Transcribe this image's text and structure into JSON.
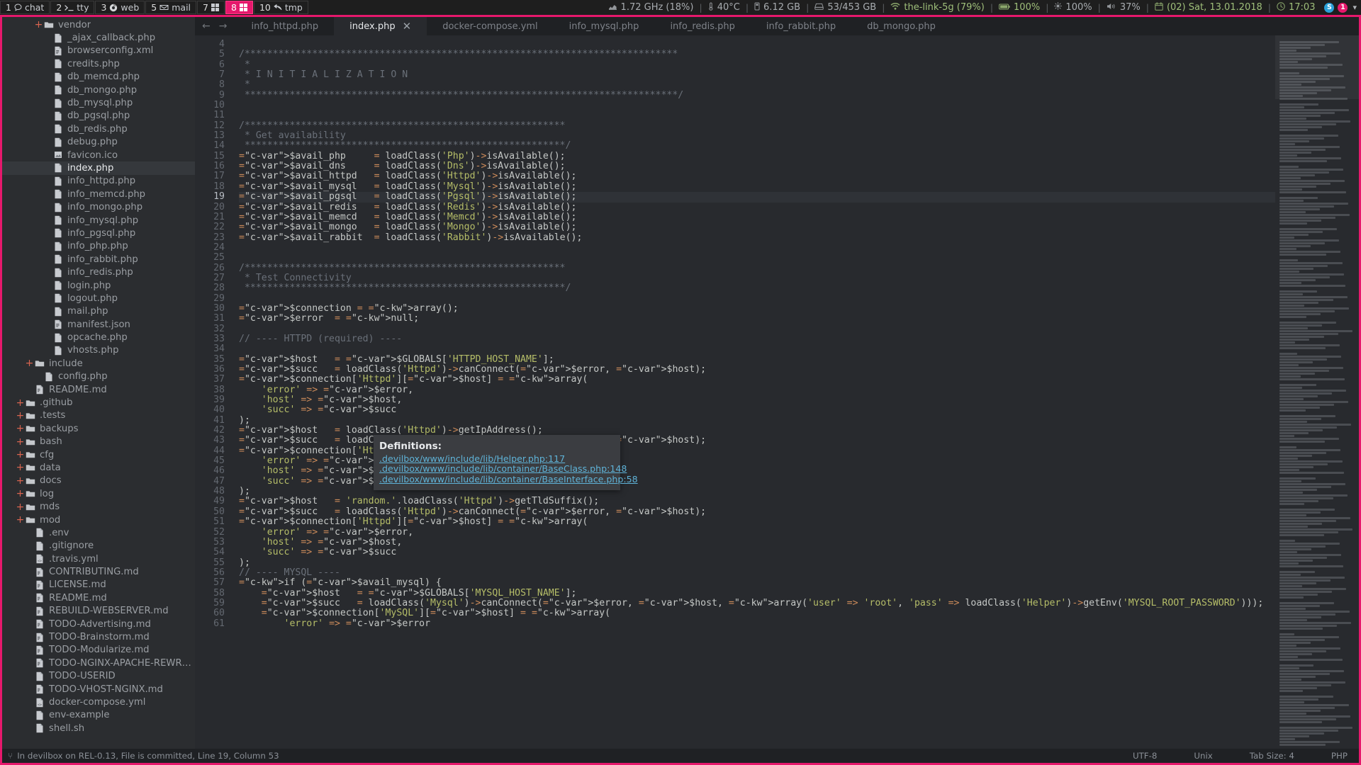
{
  "i3bar": {
    "workspaces": [
      {
        "num": "1",
        "icon": "chat-bubble-icon",
        "label": "chat",
        "active": false
      },
      {
        "num": "2",
        "icon": "terminal-prompt-icon",
        "label": "tty",
        "active": false
      },
      {
        "num": "3",
        "icon": "chrome-icon",
        "label": "web",
        "active": false
      },
      {
        "num": "5",
        "icon": "mail-icon",
        "label": "mail",
        "active": false
      },
      {
        "num": "7",
        "icon": "grid-squares-icon",
        "label": "",
        "active": false
      },
      {
        "num": "8",
        "icon": "grid-squares-icon",
        "label": "",
        "active": true
      },
      {
        "num": "10",
        "icon": "back-arrow-icon",
        "label": "tmp",
        "active": false
      }
    ],
    "tray": [
      {
        "icon": "cpu-chart-icon",
        "text": "1.72 GHz (18%)",
        "color": "#a8acb0"
      },
      {
        "icon": "thermometer-icon",
        "text": "40°C",
        "color": "#a8acb0"
      },
      {
        "icon": "memory-icon",
        "text": "6.12 GB",
        "color": "#a8acb0"
      },
      {
        "icon": "harddisk-icon",
        "text": "53/453 GB",
        "color": "#a8acb0"
      },
      {
        "icon": "wifi-icon",
        "text": "the-link-5g (79%)",
        "color": "#9fbf7a"
      },
      {
        "icon": "battery-icon",
        "text": "100%",
        "color": "#9fbf7a"
      },
      {
        "icon": "brightness-icon",
        "text": "100%",
        "color": "#a8acb0"
      },
      {
        "icon": "volume-icon",
        "text": "37%",
        "color": "#a8acb0"
      },
      {
        "icon": "calendar-icon",
        "text": "(02) Sat, 13.01.2018",
        "color": "#9fbf7a"
      },
      {
        "icon": "clock-icon",
        "text": "17:03",
        "color": "#9fbf7a"
      }
    ],
    "tray_badges": [
      {
        "name": "skype-icon",
        "label": "S",
        "color": "#2aa0d8"
      },
      {
        "name": "notification-badge",
        "label": "1",
        "color": "#e6186c"
      }
    ],
    "tray_chevron": "▾"
  },
  "sidebar": {
    "items": [
      {
        "label": "vendor",
        "type": "folder",
        "indent": 3,
        "expandable": true,
        "selected": false
      },
      {
        "label": "_ajax_callback.php",
        "type": "php",
        "indent": 4,
        "expandable": false,
        "selected": false
      },
      {
        "label": "browserconfig.xml",
        "type": "xml",
        "indent": 4,
        "expandable": false,
        "selected": false
      },
      {
        "label": "credits.php",
        "type": "php",
        "indent": 4,
        "expandable": false,
        "selected": false
      },
      {
        "label": "db_memcd.php",
        "type": "php",
        "indent": 4,
        "expandable": false,
        "selected": false
      },
      {
        "label": "db_mongo.php",
        "type": "php",
        "indent": 4,
        "expandable": false,
        "selected": false
      },
      {
        "label": "db_mysql.php",
        "type": "php",
        "indent": 4,
        "expandable": false,
        "selected": false
      },
      {
        "label": "db_pgsql.php",
        "type": "php",
        "indent": 4,
        "expandable": false,
        "selected": false
      },
      {
        "label": "db_redis.php",
        "type": "php",
        "indent": 4,
        "expandable": false,
        "selected": false
      },
      {
        "label": "debug.php",
        "type": "php",
        "indent": 4,
        "expandable": false,
        "selected": false
      },
      {
        "label": "favicon.ico",
        "type": "image",
        "indent": 4,
        "expandable": false,
        "selected": false
      },
      {
        "label": "index.php",
        "type": "php",
        "indent": 4,
        "expandable": false,
        "selected": true
      },
      {
        "label": "info_httpd.php",
        "type": "php",
        "indent": 4,
        "expandable": false,
        "selected": false
      },
      {
        "label": "info_memcd.php",
        "type": "php",
        "indent": 4,
        "expandable": false,
        "selected": false
      },
      {
        "label": "info_mongo.php",
        "type": "php",
        "indent": 4,
        "expandable": false,
        "selected": false
      },
      {
        "label": "info_mysql.php",
        "type": "php",
        "indent": 4,
        "expandable": false,
        "selected": false
      },
      {
        "label": "info_pgsql.php",
        "type": "php",
        "indent": 4,
        "expandable": false,
        "selected": false
      },
      {
        "label": "info_php.php",
        "type": "php",
        "indent": 4,
        "expandable": false,
        "selected": false
      },
      {
        "label": "info_rabbit.php",
        "type": "php",
        "indent": 4,
        "expandable": false,
        "selected": false
      },
      {
        "label": "info_redis.php",
        "type": "php",
        "indent": 4,
        "expandable": false,
        "selected": false
      },
      {
        "label": "login.php",
        "type": "php",
        "indent": 4,
        "expandable": false,
        "selected": false
      },
      {
        "label": "logout.php",
        "type": "php",
        "indent": 4,
        "expandable": false,
        "selected": false
      },
      {
        "label": "mail.php",
        "type": "php",
        "indent": 4,
        "expandable": false,
        "selected": false
      },
      {
        "label": "manifest.json",
        "type": "json",
        "indent": 4,
        "expandable": false,
        "selected": false
      },
      {
        "label": "opcache.php",
        "type": "php",
        "indent": 4,
        "expandable": false,
        "selected": false
      },
      {
        "label": "vhosts.php",
        "type": "php",
        "indent": 4,
        "expandable": false,
        "selected": false
      },
      {
        "label": "include",
        "type": "folder",
        "indent": 2,
        "expandable": true,
        "selected": false
      },
      {
        "label": "config.php",
        "type": "php",
        "indent": 3,
        "expandable": false,
        "selected": false
      },
      {
        "label": "README.md",
        "type": "markdown",
        "indent": 2,
        "expandable": false,
        "selected": false
      },
      {
        "label": ".github",
        "type": "folder",
        "indent": 1,
        "expandable": true,
        "selected": false
      },
      {
        "label": ".tests",
        "type": "folder",
        "indent": 1,
        "expandable": true,
        "selected": false
      },
      {
        "label": "backups",
        "type": "folder",
        "indent": 1,
        "expandable": true,
        "selected": false
      },
      {
        "label": "bash",
        "type": "folder",
        "indent": 1,
        "expandable": true,
        "selected": false
      },
      {
        "label": "cfg",
        "type": "folder",
        "indent": 1,
        "expandable": true,
        "selected": false
      },
      {
        "label": "data",
        "type": "folder",
        "indent": 1,
        "expandable": true,
        "selected": false
      },
      {
        "label": "docs",
        "type": "folder",
        "indent": 1,
        "expandable": true,
        "selected": false
      },
      {
        "label": "log",
        "type": "folder",
        "indent": 1,
        "expandable": true,
        "selected": false
      },
      {
        "label": "mds",
        "type": "folder",
        "indent": 1,
        "expandable": true,
        "selected": false
      },
      {
        "label": "mod",
        "type": "folder",
        "indent": 1,
        "expandable": true,
        "selected": false
      },
      {
        "label": ".env",
        "type": "file",
        "indent": 2,
        "expandable": false,
        "selected": false
      },
      {
        "label": ".gitignore",
        "type": "file",
        "indent": 2,
        "expandable": false,
        "selected": false
      },
      {
        "label": ".travis.yml",
        "type": "yml",
        "indent": 2,
        "expandable": false,
        "selected": false
      },
      {
        "label": "CONTRIBUTING.md",
        "type": "markdown",
        "indent": 2,
        "expandable": false,
        "selected": false
      },
      {
        "label": "LICENSE.md",
        "type": "markdown",
        "indent": 2,
        "expandable": false,
        "selected": false
      },
      {
        "label": "README.md",
        "type": "markdown",
        "indent": 2,
        "expandable": false,
        "selected": false
      },
      {
        "label": "REBUILD-WEBSERVER.md",
        "type": "markdown",
        "indent": 2,
        "expandable": false,
        "selected": false
      },
      {
        "label": "TODO-Advertising.md",
        "type": "markdown",
        "indent": 2,
        "expandable": false,
        "selected": false
      },
      {
        "label": "TODO-Brainstorm.md",
        "type": "markdown",
        "indent": 2,
        "expandable": false,
        "selected": false
      },
      {
        "label": "TODO-Modularize.md",
        "type": "markdown",
        "indent": 2,
        "expandable": false,
        "selected": false
      },
      {
        "label": "TODO-NGINX-APACHE-REWRITE.md",
        "type": "markdown",
        "indent": 2,
        "expandable": false,
        "selected": false
      },
      {
        "label": "TODO-USERID",
        "type": "file",
        "indent": 2,
        "expandable": false,
        "selected": false
      },
      {
        "label": "TODO-VHOST-NGINX.md",
        "type": "markdown",
        "indent": 2,
        "expandable": false,
        "selected": false
      },
      {
        "label": "docker-compose.yml",
        "type": "yml",
        "indent": 2,
        "expandable": false,
        "selected": false
      },
      {
        "label": "env-example",
        "type": "file",
        "indent": 2,
        "expandable": false,
        "selected": false
      },
      {
        "label": "shell.sh",
        "type": "file",
        "indent": 2,
        "expandable": false,
        "selected": false
      }
    ]
  },
  "tabbar": {
    "back_arrow": "←",
    "forward_arrow": "→",
    "close_glyph": "✕",
    "tabs": [
      {
        "label": "info_httpd.php",
        "active": false
      },
      {
        "label": "index.php",
        "active": true
      },
      {
        "label": "docker-compose.yml",
        "active": false
      },
      {
        "label": "info_mysql.php",
        "active": false
      },
      {
        "label": "info_redis.php",
        "active": false
      },
      {
        "label": "info_rabbit.php",
        "active": false
      },
      {
        "label": "db_mongo.php",
        "active": false
      }
    ]
  },
  "editor": {
    "first_line": 4,
    "current_line": 19,
    "lines": [
      "",
      "/*****************************************************************************",
      " *",
      " * I N I T I A L I Z A T I O N",
      " *",
      " *****************************************************************************/",
      "",
      "",
      "/*********************************************************",
      " * Get availability",
      " *********************************************************/",
      "$avail_php     = loadClass('Php')->isAvailable();",
      "$avail_dns     = loadClass('Dns')->isAvailable();",
      "$avail_httpd   = loadClass('Httpd')->isAvailable();",
      "$avail_mysql   = loadClass('Mysql')->isAvailable();",
      "$avail_pgsql   = loadClass('Pgsql')->isAvailable();",
      "$avail_redis   = loadClass('Redis')->isAvailable();",
      "$avail_memcd   = loadClass('Memcd')->isAvailable();",
      "$avail_mongo   = loadClass('Mongo')->isAvailable();",
      "$avail_rabbit  = loadClass('Rabbit')->isAvailable();",
      "",
      "",
      "/*********************************************************",
      " * Test Connectivity",
      " *********************************************************/",
      "",
      "$connection = array();",
      "$error  = null;",
      "",
      "// ---- HTTPD (required) ----",
      "",
      "$host   = $GLOBALS['HTTPD_HOST_NAME'];",
      "$succ   = loadClass('Httpd')->canConnect($error, $host);",
      "$connection['Httpd'][$host] = array(",
      "    'error' => $error,",
      "    'host' => $host,",
      "    'succ' => $succ",
      ");",
      "$host   = loadClass('Httpd')->getIpAddress();",
      "$succ   = loadClass('Httpd')->canConnect($error, $host);",
      "$connection['Httpd'][$host] = array(",
      "    'error' => $error,",
      "    'host' => $host,",
      "    'succ' => $succ",
      ");",
      "$host   = 'random.'.loadClass('Httpd')->getTldSuffix();",
      "$succ   = loadClass('Httpd')->canConnect($error, $host);",
      "$connection['Httpd'][$host] = array(",
      "    'error' => $error,",
      "    'host' => $host,",
      "    'succ' => $succ",
      ");",
      "// ---- MYSQL ----",
      "if ($avail_mysql) {",
      "    $host   = $GLOBALS['MYSQL_HOST_NAME'];",
      "    $succ   = loadClass('Mysql')->canConnect($error, $host, array('user' => 'root', 'pass' => loadClass('Helper')->getEnv('MYSQL_ROOT_PASSWORD')));",
      "    $connection['MySQL'][$host] = array(",
      "        'error' => $error"
    ]
  },
  "definitions_popup": {
    "title": "Definitions:",
    "links": [
      ".devilbox/www/include/lib/Helper.php:117",
      ".devilbox/www/include/lib/container/BaseClass.php:148",
      ".devilbox/www/include/lib/container/BaseInterface.php:58"
    ]
  },
  "statusbar": {
    "left_icon": "git-branch-icon",
    "left_text": "In devilbox on REL-0.13, File is committed, Line 19, Column 53",
    "right": [
      "UTF-8",
      "Unix",
      "Tab Size: 4",
      "PHP"
    ]
  }
}
